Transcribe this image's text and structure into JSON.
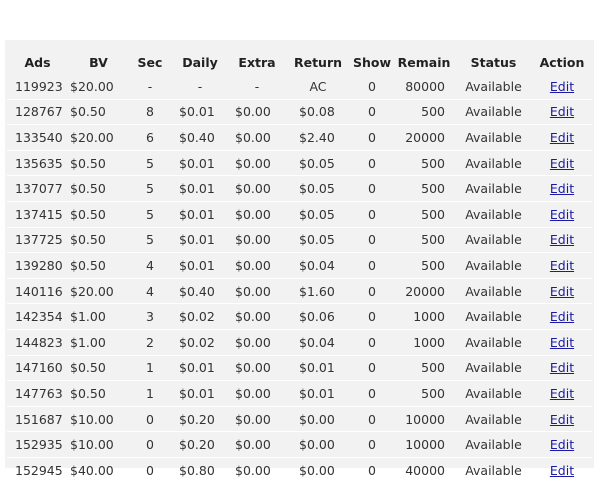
{
  "table": {
    "headers": [
      "Ads",
      "BV",
      "Sec",
      "Daily",
      "Extra",
      "Return",
      "Show",
      "Remain",
      "Status",
      "Action"
    ],
    "rows": [
      {
        "ads": "119923",
        "bv": "$20.00",
        "sec": "-",
        "daily": "-",
        "extra": "-",
        "return": "AC",
        "show": "0",
        "remain": "80000",
        "status": "Available",
        "action": "Edit"
      },
      {
        "ads": "128767",
        "bv": "$0.50",
        "sec": "8",
        "daily": "$0.01",
        "extra": "$0.00",
        "return": "$0.08",
        "show": "0",
        "remain": "500",
        "status": "Available",
        "action": "Edit"
      },
      {
        "ads": "133540",
        "bv": "$20.00",
        "sec": "6",
        "daily": "$0.40",
        "extra": "$0.00",
        "return": "$2.40",
        "show": "0",
        "remain": "20000",
        "status": "Available",
        "action": "Edit"
      },
      {
        "ads": "135635",
        "bv": "$0.50",
        "sec": "5",
        "daily": "$0.01",
        "extra": "$0.00",
        "return": "$0.05",
        "show": "0",
        "remain": "500",
        "status": "Available",
        "action": "Edit"
      },
      {
        "ads": "137077",
        "bv": "$0.50",
        "sec": "5",
        "daily": "$0.01",
        "extra": "$0.00",
        "return": "$0.05",
        "show": "0",
        "remain": "500",
        "status": "Available",
        "action": "Edit"
      },
      {
        "ads": "137415",
        "bv": "$0.50",
        "sec": "5",
        "daily": "$0.01",
        "extra": "$0.00",
        "return": "$0.05",
        "show": "0",
        "remain": "500",
        "status": "Available",
        "action": "Edit"
      },
      {
        "ads": "137725",
        "bv": "$0.50",
        "sec": "5",
        "daily": "$0.01",
        "extra": "$0.00",
        "return": "$0.05",
        "show": "0",
        "remain": "500",
        "status": "Available",
        "action": "Edit"
      },
      {
        "ads": "139280",
        "bv": "$0.50",
        "sec": "4",
        "daily": "$0.01",
        "extra": "$0.00",
        "return": "$0.04",
        "show": "0",
        "remain": "500",
        "status": "Available",
        "action": "Edit"
      },
      {
        "ads": "140116",
        "bv": "$20.00",
        "sec": "4",
        "daily": "$0.40",
        "extra": "$0.00",
        "return": "$1.60",
        "show": "0",
        "remain": "20000",
        "status": "Available",
        "action": "Edit"
      },
      {
        "ads": "142354",
        "bv": "$1.00",
        "sec": "3",
        "daily": "$0.02",
        "extra": "$0.00",
        "return": "$0.06",
        "show": "0",
        "remain": "1000",
        "status": "Available",
        "action": "Edit"
      },
      {
        "ads": "144823",
        "bv": "$1.00",
        "sec": "2",
        "daily": "$0.02",
        "extra": "$0.00",
        "return": "$0.04",
        "show": "0",
        "remain": "1000",
        "status": "Available",
        "action": "Edit"
      },
      {
        "ads": "147160",
        "bv": "$0.50",
        "sec": "1",
        "daily": "$0.01",
        "extra": "$0.00",
        "return": "$0.01",
        "show": "0",
        "remain": "500",
        "status": "Available",
        "action": "Edit"
      },
      {
        "ads": "147763",
        "bv": "$0.50",
        "sec": "1",
        "daily": "$0.01",
        "extra": "$0.00",
        "return": "$0.01",
        "show": "0",
        "remain": "500",
        "status": "Available",
        "action": "Edit"
      },
      {
        "ads": "151687",
        "bv": "$10.00",
        "sec": "0",
        "daily": "$0.20",
        "extra": "$0.00",
        "return": "$0.00",
        "show": "0",
        "remain": "10000",
        "status": "Available",
        "action": "Edit"
      },
      {
        "ads": "152935",
        "bv": "$10.00",
        "sec": "0",
        "daily": "$0.20",
        "extra": "$0.00",
        "return": "$0.00",
        "show": "0",
        "remain": "10000",
        "status": "Available",
        "action": "Edit"
      },
      {
        "ads": "152945",
        "bv": "$40.00",
        "sec": "0",
        "daily": "$0.80",
        "extra": "$0.00",
        "return": "$0.00",
        "show": "0",
        "remain": "40000",
        "status": "Available",
        "action": "Edit"
      }
    ]
  },
  "colors": {
    "panel_background": "#f2f2f2",
    "link": "#1a1aa6"
  }
}
